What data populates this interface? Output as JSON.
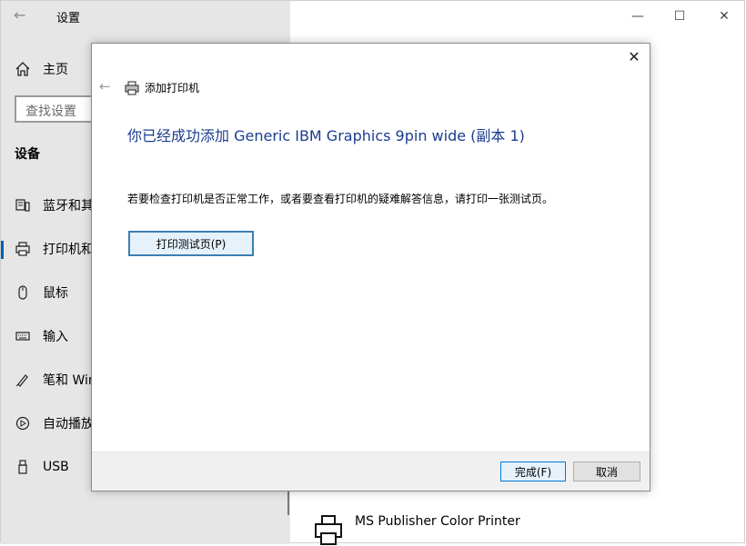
{
  "settings": {
    "title": "设置",
    "home_label": "主页",
    "search_placeholder": "查找设置",
    "section_title": "设备",
    "nav": [
      {
        "label": "蓝牙和其",
        "icon": "bluetooth-device-icon"
      },
      {
        "label": "打印机和",
        "icon": "printer-icon",
        "selected": true
      },
      {
        "label": "鼠标",
        "icon": "mouse-icon"
      },
      {
        "label": "输入",
        "icon": "keyboard-icon"
      },
      {
        "label": "笔和 Win",
        "icon": "pen-icon"
      },
      {
        "label": "自动播放",
        "icon": "autoplay-icon"
      },
      {
        "label": "USB",
        "icon": "usb-icon"
      }
    ],
    "window_controls": {
      "minimize": "—",
      "maximize": "☐",
      "close": "✕"
    },
    "printer_list_item": "MS Publisher Color Printer"
  },
  "dialog": {
    "header": "添加打印机",
    "main_title": "你已经成功添加 Generic IBM Graphics 9pin wide (副本 1)",
    "info": "若要检查打印机是否正常工作，或者要查看打印机的疑难解答信息，请打印一张测试页。",
    "test_button": "打印测试页(P)",
    "finish_button": "完成(F)",
    "cancel_button": "取消",
    "close": "✕",
    "back": "←"
  },
  "colors": {
    "accent": "#0063b1",
    "title_blue": "#1a3c8f",
    "sidebar_bg": "#e6e6e6"
  }
}
